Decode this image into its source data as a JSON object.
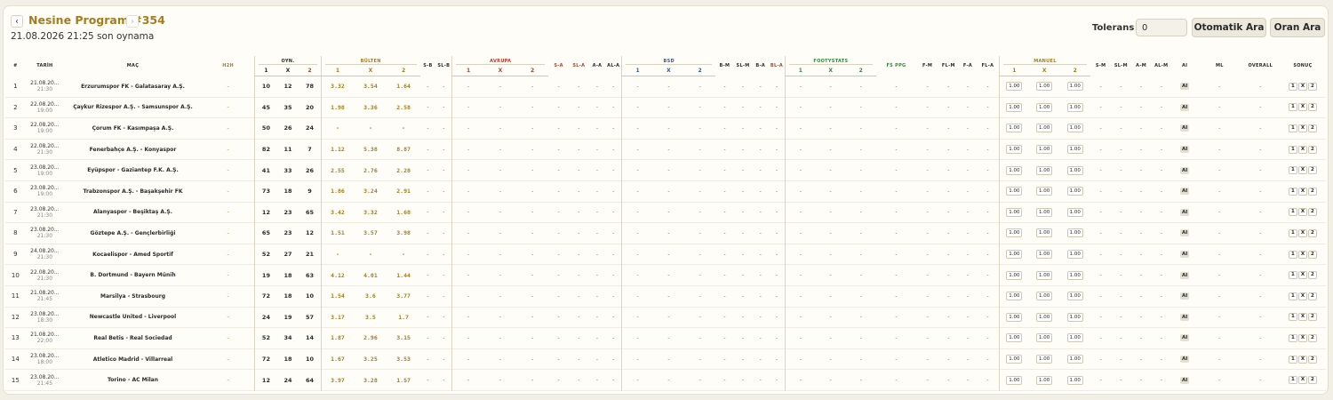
{
  "header": {
    "program_title": "Nesine Program #354",
    "subtitle": "21.08.2026 21:25 son oynama",
    "prev_icon": "‹",
    "next_icon": "›",
    "tolerance_label": "Tolerans ±",
    "tolerance_value": "0",
    "auto_search_label": "Otomatik Ara",
    "odds_search_label": "Oran Ara"
  },
  "colors": {
    "accent_gold": "#a67c1f",
    "avrupa_red": "#b83c2a",
    "bsd_blue": "#2d5aa8",
    "footystats_green": "#2e8b3a"
  },
  "columns": {
    "idx": "#",
    "date": "TARİH",
    "match": "MAÇ",
    "h2h": "H2H",
    "oyn": "OYN.",
    "bulten": "BÜLTEN",
    "sb": "S-B",
    "slb": "SL-B",
    "avrupa": "AVRUPA",
    "sa": "S-A",
    "sla": "SL-A",
    "aa": "A-A",
    "ala": "AL-A",
    "bsd": "BSD",
    "bm": "B-M",
    "slm": "SL-M",
    "ba": "B-A",
    "bla": "BL-A",
    "footystats": "FOOTYSTATS",
    "fsppg": "FS PPG",
    "fm": "F-M",
    "flm": "FL-M",
    "fa": "F-A",
    "fla": "FL-A",
    "manuel": "MANUEL",
    "sm": "S-M",
    "slm2": "SL-M",
    "am": "A-M",
    "alm": "AL-M",
    "ai": "AI",
    "ml": "ML",
    "overall": "OVERALL",
    "sonuc": "SONUÇ",
    "one": "1",
    "x": "X",
    "two": "2"
  },
  "cell_texts": {
    "dash": "-",
    "manual_default": "1.00",
    "ai_badge": "AI",
    "res_1": "1",
    "res_x": "X",
    "res_2": "2"
  },
  "rows": [
    {
      "idx": "1",
      "date": "21.08.20...",
      "time": "21:30",
      "match": "Erzurumspor FK - Galatasaray A.Ş.",
      "oyn": [
        "10",
        "12",
        "78"
      ],
      "bulten": [
        "3.32",
        "3.54",
        "1.64"
      ]
    },
    {
      "idx": "2",
      "date": "22.08.20...",
      "time": "19:00",
      "match": "Çaykur Rizespor A.Ş. - Samsunspor A.Ş.",
      "oyn": [
        "45",
        "35",
        "20"
      ],
      "bulten": [
        "1.98",
        "3.36",
        "2.58"
      ]
    },
    {
      "idx": "3",
      "date": "22.08.20...",
      "time": "19:00",
      "match": "Çorum FK - Kasımpaşa A.Ş.",
      "oyn": [
        "50",
        "26",
        "24"
      ],
      "bulten": [
        "-",
        "-",
        "-"
      ]
    },
    {
      "idx": "4",
      "date": "22.08.20...",
      "time": "21:30",
      "match": "Fenerbahçe A.Ş. - Konyaspor",
      "oyn": [
        "82",
        "11",
        "7"
      ],
      "bulten": [
        "1.12",
        "5.38",
        "8.87"
      ]
    },
    {
      "idx": "5",
      "date": "23.08.20...",
      "time": "19:00",
      "match": "Eyüpspor - Gaziantep F.K. A.Ş.",
      "oyn": [
        "41",
        "33",
        "26"
      ],
      "bulten": [
        "2.55",
        "2.76",
        "2.28"
      ]
    },
    {
      "idx": "6",
      "date": "23.08.20...",
      "time": "19:00",
      "match": "Trabzonspor A.Ş. - Başakşehir FK",
      "oyn": [
        "73",
        "18",
        "9"
      ],
      "bulten": [
        "1.86",
        "3.24",
        "2.91"
      ]
    },
    {
      "idx": "7",
      "date": "23.08.20...",
      "time": "21:30",
      "match": "Alanyaspor - Beşiktaş A.Ş.",
      "oyn": [
        "12",
        "23",
        "65"
      ],
      "bulten": [
        "3.42",
        "3.32",
        "1.68"
      ]
    },
    {
      "idx": "8",
      "date": "23.08.20...",
      "time": "21:30",
      "match": "Göztepe A.Ş. - Gençlerbirliği",
      "oyn": [
        "65",
        "23",
        "12"
      ],
      "bulten": [
        "1.51",
        "3.57",
        "3.98"
      ]
    },
    {
      "idx": "9",
      "date": "24.08.20...",
      "time": "21:30",
      "match": "Kocaelispor - Amed Sportif",
      "oyn": [
        "52",
        "27",
        "21"
      ],
      "bulten": [
        "-",
        "-",
        "-"
      ]
    },
    {
      "idx": "10",
      "date": "22.08.20...",
      "time": "21:30",
      "match": "B. Dortmund - Bayern Münih",
      "oyn": [
        "19",
        "18",
        "63"
      ],
      "bulten": [
        "4.12",
        "4.01",
        "1.44"
      ]
    },
    {
      "idx": "11",
      "date": "21.08.20...",
      "time": "21:45",
      "match": "Marsilya - Strasbourg",
      "oyn": [
        "72",
        "18",
        "10"
      ],
      "bulten": [
        "1.54",
        "3.6",
        "3.77"
      ]
    },
    {
      "idx": "12",
      "date": "23.08.20...",
      "time": "18:30",
      "match": "Newcastle United - Liverpool",
      "oyn": [
        "24",
        "19",
        "57"
      ],
      "bulten": [
        "3.17",
        "3.5",
        "1.7"
      ]
    },
    {
      "idx": "13",
      "date": "21.08.20...",
      "time": "22:00",
      "match": "Real Betis - Real Sociedad",
      "oyn": [
        "52",
        "34",
        "14"
      ],
      "bulten": [
        "1.87",
        "2.96",
        "3.15"
      ]
    },
    {
      "idx": "14",
      "date": "23.08.20...",
      "time": "18:00",
      "match": "Atletico Madrid - Villarreal",
      "oyn": [
        "72",
        "18",
        "10"
      ],
      "bulten": [
        "1.67",
        "3.25",
        "3.53"
      ]
    },
    {
      "idx": "15",
      "date": "23.08.20...",
      "time": "21:45",
      "match": "Torino - AC Milan",
      "oyn": [
        "12",
        "24",
        "64"
      ],
      "bulten": [
        "3.97",
        "3.28",
        "1.57"
      ]
    }
  ]
}
